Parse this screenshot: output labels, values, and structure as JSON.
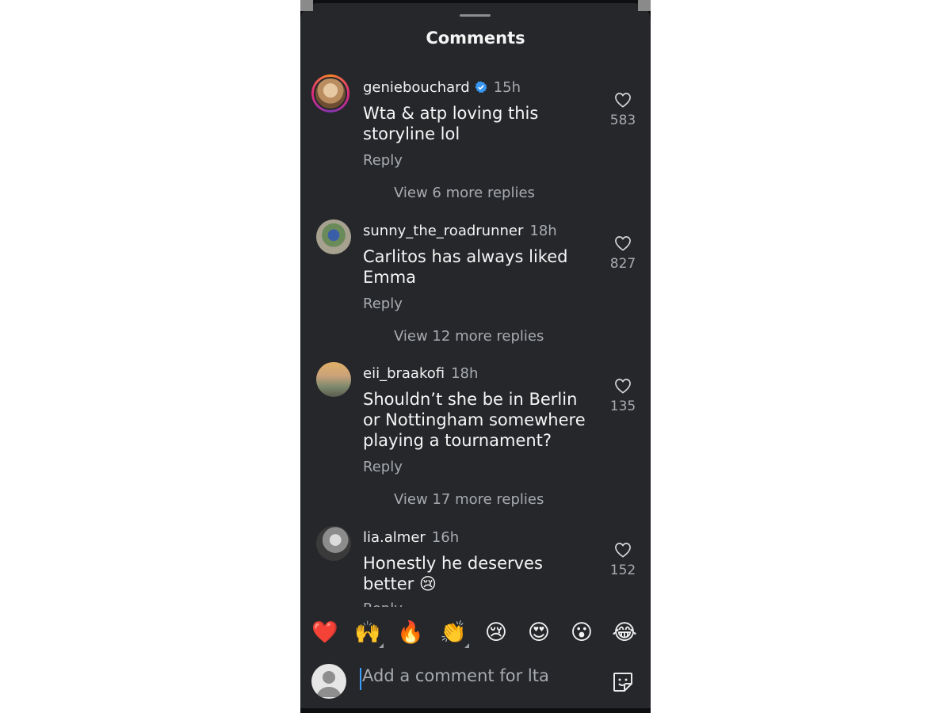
{
  "sheet": {
    "title": "Comments"
  },
  "comments": [
    {
      "username": "geniebouchard",
      "verified": true,
      "time": "15h",
      "text": "Wta & atp loving this storyline lol",
      "reply_label": "Reply",
      "view_replies": "View 6 more replies",
      "likes": "583"
    },
    {
      "username": "sunny_the_roadrunner",
      "verified": false,
      "time": "18h",
      "text": "Carlitos has always liked Emma",
      "reply_label": "Reply",
      "view_replies": "View 12 more replies",
      "likes": "827"
    },
    {
      "username": "eii_braakofi",
      "verified": false,
      "time": "18h",
      "text": "Shouldn’t she be in Berlin or Nottingham somewhere playing a tournament?",
      "reply_label": "Reply",
      "view_replies": "View 17 more replies",
      "likes": "135"
    },
    {
      "username": "lia.almer",
      "verified": false,
      "time": "16h",
      "text": "Honestly he deserves better 😢",
      "reply_label": "Reply",
      "likes": "152"
    }
  ],
  "reactions": [
    "❤️",
    "🙌",
    "🔥",
    "👏",
    "😢",
    "😍",
    "😮",
    "😂"
  ],
  "composer": {
    "placeholder": "Add a comment for lta"
  },
  "icons": {
    "like": "heart-outline-icon",
    "verified": "verified-badge-icon",
    "sticker": "sticker-icon",
    "accent": "#3897f0"
  }
}
